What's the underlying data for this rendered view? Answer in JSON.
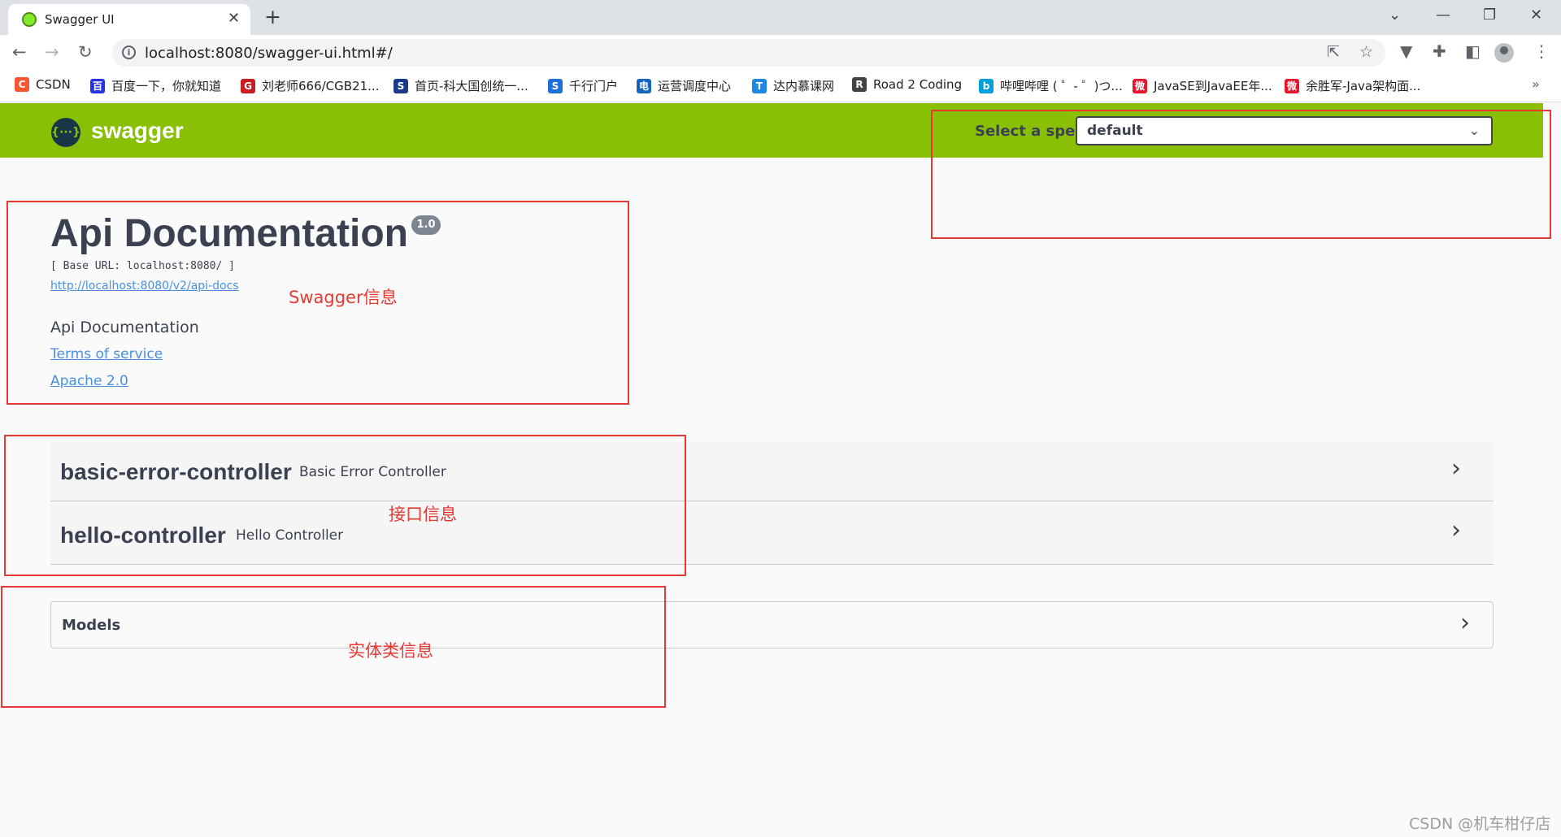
{
  "browser": {
    "tab_title": "Swagger UI",
    "tab_close": "✕",
    "new_tab": "+",
    "url": "localhost:8080/swagger-ui.html#/",
    "window_controls": {
      "dropdown": "⌄",
      "minimize": "—",
      "restore": "❐",
      "close": "✕"
    },
    "nav": {
      "back": "←",
      "forward": "→",
      "reload": "↻"
    },
    "bookmarks": [
      {
        "label": "CSDN",
        "icon": "csdn-icon",
        "color": "#fc5531"
      },
      {
        "label": "百度一下，你就知道",
        "icon": "baidu-icon",
        "color": "#2932e1"
      },
      {
        "label": "刘老师666/CGB21...",
        "icon": "gitee-icon",
        "color": "#c71d23"
      },
      {
        "label": "首页-科大国创统一...",
        "icon": "shield-icon",
        "color": "#1a3a8a"
      },
      {
        "label": "千行门户",
        "icon": "shield-icon",
        "color": "#1e6fd9"
      },
      {
        "label": "运营调度中心",
        "icon": "telecom-icon",
        "color": "#1565c0"
      },
      {
        "label": "达内慕课网",
        "icon": "tedu-icon",
        "color": "#1e88e5"
      },
      {
        "label": "Road 2 Coding",
        "icon": "road-icon",
        "color": "#424242"
      },
      {
        "label": "哔哩哔哩 ( ゜- ゜)つ...",
        "icon": "bilibili-icon",
        "color": "#00a1d6"
      },
      {
        "label": "JavaSE到JavaEE年...",
        "icon": "weibo-icon",
        "color": "#e6162d"
      },
      {
        "label": "余胜军-Java架构面...",
        "icon": "weibo-icon",
        "color": "#e6162d"
      }
    ],
    "more_bookmarks": "»"
  },
  "swagger": {
    "logo_text": "swagger",
    "logo_glyph": "{···}",
    "spec_label": "Select a spec",
    "spec_value": "default",
    "accent": "#89bf04"
  },
  "info": {
    "title": "Api Documentation",
    "version": "1.0",
    "base_url": "[ Base URL: localhost:8080/ ]",
    "docs_link": "http://localhost:8080/v2/api-docs",
    "description": "Api Documentation",
    "terms": "Terms of service",
    "license": "Apache 2.0"
  },
  "controllers": [
    {
      "name": "basic-error-controller",
      "description": "Basic Error Controller"
    },
    {
      "name": "hello-controller",
      "description": "Hello Controller"
    }
  ],
  "models": {
    "label": "Models"
  },
  "annotations": {
    "swagger_info": "Swagger信息",
    "api_info": "接口信息",
    "entity_info": "实体类信息"
  },
  "watermark": "CSDN @机车柑仔店"
}
